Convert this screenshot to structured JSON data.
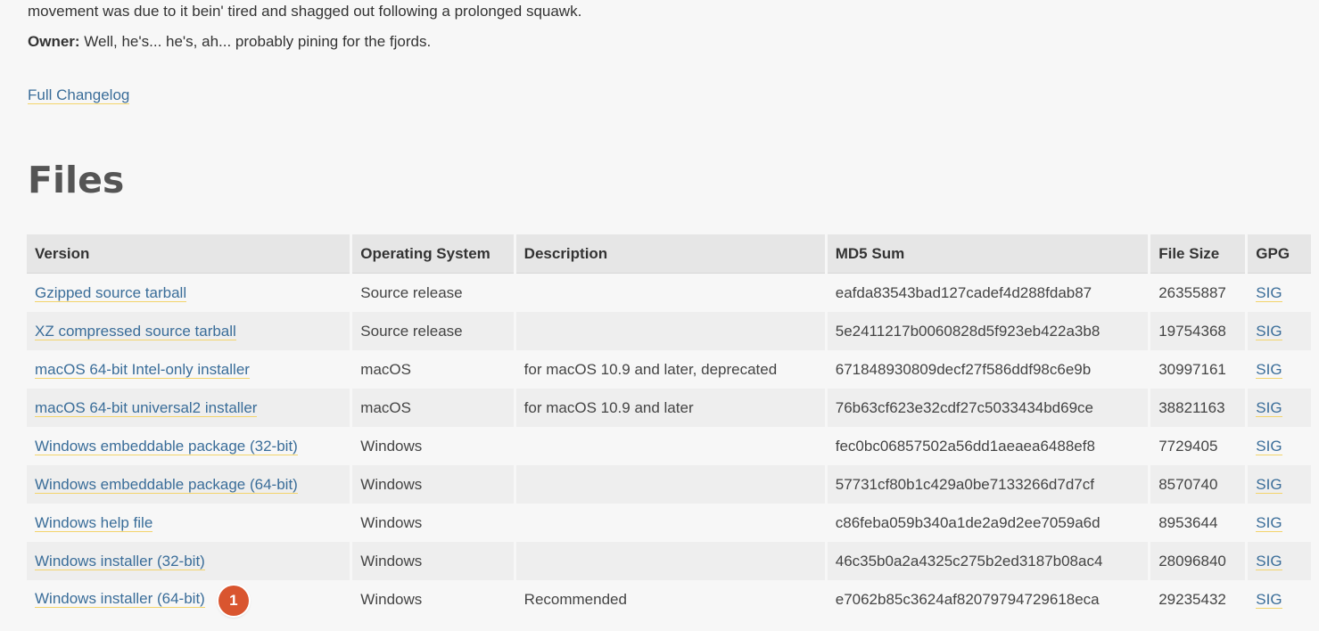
{
  "intro": {
    "line1": "movement was due to it bein' tired and shagged out following a prolonged squawk.",
    "owner_label": "Owner:",
    "owner_text": " Well, he's... he's, ah... probably pining for the fjords."
  },
  "changelog_link": "Full Changelog",
  "files_title": "Files",
  "table": {
    "headers": {
      "version": "Version",
      "os": "Operating System",
      "description": "Description",
      "md5": "MD5 Sum",
      "size": "File Size",
      "gpg": "GPG"
    },
    "rows": [
      {
        "version": "Gzipped source tarball",
        "os": "Source release",
        "description": "",
        "md5": "eafda83543bad127cadef4d288fdab87",
        "size": "26355887",
        "gpg": "SIG"
      },
      {
        "version": "XZ compressed source tarball",
        "os": "Source release",
        "description": "",
        "md5": "5e2411217b0060828d5f923eb422a3b8",
        "size": "19754368",
        "gpg": "SIG"
      },
      {
        "version": "macOS 64-bit Intel-only installer",
        "os": "macOS",
        "description": "for macOS 10.9 and later, deprecated",
        "md5": "671848930809decf27f586ddf98c6e9b",
        "size": "30997161",
        "gpg": "SIG"
      },
      {
        "version": "macOS 64-bit universal2 installer",
        "os": "macOS",
        "description": "for macOS 10.9 and later",
        "md5": "76b63cf623e32cdf27c5033434bd69ce",
        "size": "38821163",
        "gpg": "SIG"
      },
      {
        "version": "Windows embeddable package (32-bit)",
        "os": "Windows",
        "description": "",
        "md5": "fec0bc06857502a56dd1aeaea6488ef8",
        "size": "7729405",
        "gpg": "SIG"
      },
      {
        "version": "Windows embeddable package (64-bit)",
        "os": "Windows",
        "description": "",
        "md5": "57731cf80b1c429a0be7133266d7d7cf",
        "size": "8570740",
        "gpg": "SIG"
      },
      {
        "version": "Windows help file",
        "os": "Windows",
        "description": "",
        "md5": "c86feba059b340a1de2a9d2ee7059a6d",
        "size": "8953644",
        "gpg": "SIG"
      },
      {
        "version": "Windows installer (32-bit)",
        "os": "Windows",
        "description": "",
        "md5": "46c35b0a2a4325c275b2ed3187b08ac4",
        "size": "28096840",
        "gpg": "SIG"
      },
      {
        "version": "Windows installer (64-bit)",
        "os": "Windows",
        "description": "Recommended",
        "md5": "e7062b85c3624af82079794729618eca",
        "size": "29235432",
        "gpg": "SIG"
      }
    ]
  },
  "badge": {
    "label": "1",
    "color": "#d9552f"
  },
  "colors": {
    "link": "#3a6d99",
    "link_underline": "#f3d46b",
    "header_bg": "#e6e6e6"
  }
}
